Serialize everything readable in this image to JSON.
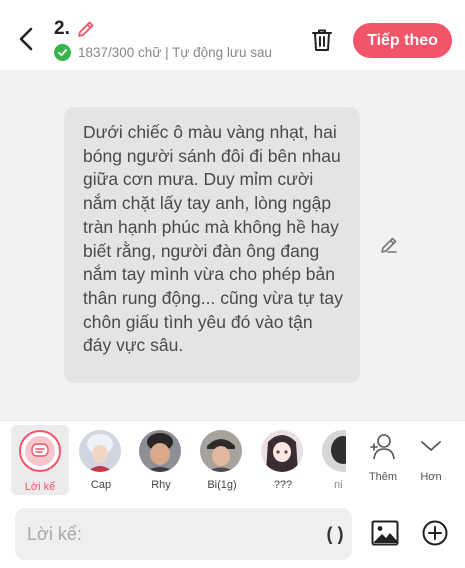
{
  "header": {
    "title": "2.",
    "status": "1837/300 chữ | Tự động lưu sau",
    "next_label": "Tiếp theo"
  },
  "bubble": {
    "text": "Dưới chiếc ô màu vàng nhạt, hai bóng người sánh đôi đi bên nhau giữa cơn mưa. Duy mỉm cười nắm chặt lấy tay anh, lòng ngập tràn hạnh phúc mà không hề hay biết rằng, người đàn ông đang nắm tay mình vừa cho phép bản thân rung động... cũng vừa tự tay chôn giấu tình yêu đó vào tận đáy vực sâu."
  },
  "characters": [
    {
      "label": "Lời kể",
      "selected": true
    },
    {
      "label": "Cap"
    },
    {
      "label": "Rhy"
    },
    {
      "label": "Bi(1g)"
    },
    {
      "label": "???"
    },
    {
      "label": "ni"
    }
  ],
  "actions": {
    "add_label": "Thêm",
    "more_label": "Hơn"
  },
  "input": {
    "placeholder": "Lời kể:",
    "paren_label": "( )"
  },
  "colors": {
    "accent": "#f2546a",
    "check": "#38b54a"
  }
}
